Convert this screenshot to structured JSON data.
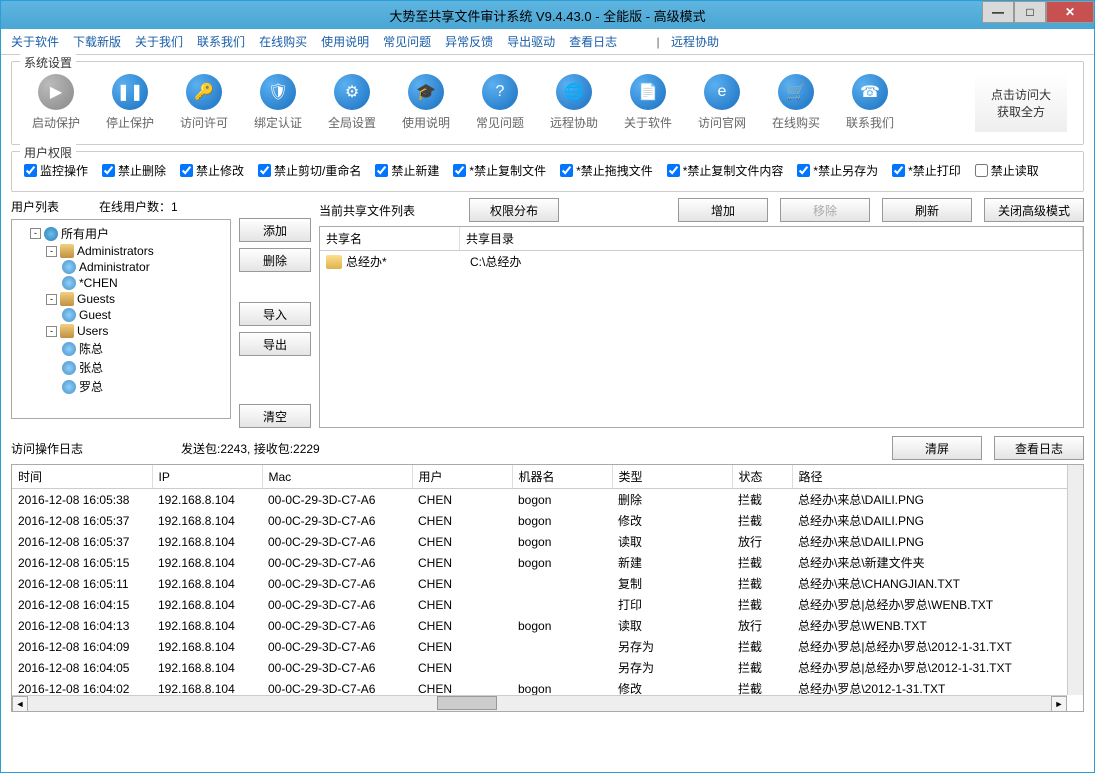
{
  "title": "大势至共享文件审计系统 V9.4.43.0 - 全能版 - 高级模式",
  "menu": [
    "关于软件",
    "下载新版",
    "关于我们",
    "联系我们",
    "在线购买",
    "使用说明",
    "常见问题",
    "异常反馈",
    "导出驱动",
    "查看日志"
  ],
  "menu_sep": "|",
  "menu_remote": "远程协助",
  "group_system": "系统设置",
  "toolbar": [
    {
      "label": "启动保护",
      "glyph": "▶",
      "gray": true
    },
    {
      "label": "停止保护",
      "glyph": "❚❚"
    },
    {
      "label": "访问许可",
      "glyph": "🔑"
    },
    {
      "label": "绑定认证",
      "glyph": "🛡"
    },
    {
      "label": "全局设置",
      "glyph": "⚙"
    },
    {
      "label": "使用说明",
      "glyph": "🎓"
    },
    {
      "label": "常见问题",
      "glyph": "?"
    },
    {
      "label": "远程协助",
      "glyph": "🌐"
    },
    {
      "label": "关于软件",
      "glyph": "📄"
    },
    {
      "label": "访问官网",
      "glyph": "e"
    },
    {
      "label": "在线购买",
      "glyph": "🛒"
    },
    {
      "label": "联系我们",
      "glyph": "☎"
    }
  ],
  "banner_l1": "点击访问大",
  "banner_l2": "获取全方",
  "group_perm": "用户权限",
  "perms": [
    {
      "label": "监控操作",
      "checked": true
    },
    {
      "label": "禁止删除",
      "checked": true
    },
    {
      "label": "禁止修改",
      "checked": true
    },
    {
      "label": "禁止剪切/重命名",
      "checked": true
    },
    {
      "label": "禁止新建",
      "checked": true
    },
    {
      "label": "*禁止复制文件",
      "checked": true
    },
    {
      "label": "*禁止拖拽文件",
      "checked": true
    },
    {
      "label": "*禁止复制文件内容",
      "checked": true
    },
    {
      "label": "*禁止另存为",
      "checked": true
    },
    {
      "label": "*禁止打印",
      "checked": true
    },
    {
      "label": "禁止读取",
      "checked": false
    }
  ],
  "user_list_label": "用户列表",
  "online_users": "在线用户数：1",
  "tree": {
    "root": "所有用户",
    "groups": [
      {
        "name": "Administrators",
        "users": [
          "Administrator",
          "*CHEN"
        ]
      },
      {
        "name": "Guests",
        "users": [
          "Guest"
        ]
      },
      {
        "name": "Users",
        "users": [
          "陈总",
          "张总",
          "罗总"
        ]
      }
    ]
  },
  "btns_col": [
    "添加",
    "删除",
    "导入",
    "导出",
    "清空"
  ],
  "share_label": "当前共享文件列表",
  "btn_perm_dist": "权限分布",
  "btn_add": "增加",
  "btn_remove": "移除",
  "btn_refresh": "刷新",
  "btn_close_adv": "关闭高级模式",
  "share_cols": {
    "name": "共享名",
    "dir": "共享目录"
  },
  "share_rows": [
    {
      "name": "总经办*",
      "dir": "C:\\总经办"
    }
  ],
  "log_label": "访问操作日志",
  "log_stats": "发送包:2243, 接收包:2229",
  "btn_clear": "清屏",
  "btn_viewlog": "查看日志",
  "log_cols": [
    "时间",
    "IP",
    "Mac",
    "用户",
    "机器名",
    "类型",
    "状态",
    "路径"
  ],
  "log_rows": [
    [
      "2016-12-08 16:05:38",
      "192.168.8.104",
      "00-0C-29-3D-C7-A6",
      "CHEN",
      "bogon",
      "删除",
      "拦截",
      "总经办\\来总\\DAILI.PNG"
    ],
    [
      "2016-12-08 16:05:37",
      "192.168.8.104",
      "00-0C-29-3D-C7-A6",
      "CHEN",
      "bogon",
      "修改",
      "拦截",
      "总经办\\来总\\DAILI.PNG"
    ],
    [
      "2016-12-08 16:05:37",
      "192.168.8.104",
      "00-0C-29-3D-C7-A6",
      "CHEN",
      "bogon",
      "读取",
      "放行",
      "总经办\\来总\\DAILI.PNG"
    ],
    [
      "2016-12-08 16:05:15",
      "192.168.8.104",
      "00-0C-29-3D-C7-A6",
      "CHEN",
      "bogon",
      "新建",
      "拦截",
      "总经办\\来总\\新建文件夹"
    ],
    [
      "2016-12-08 16:05:11",
      "192.168.8.104",
      "00-0C-29-3D-C7-A6",
      "CHEN",
      "",
      "复制",
      "拦截",
      "总经办\\来总\\CHANGJIAN.TXT"
    ],
    [
      "2016-12-08 16:04:15",
      "192.168.8.104",
      "00-0C-29-3D-C7-A6",
      "CHEN",
      "",
      "打印",
      "拦截",
      "总经办\\罗总|总经办\\罗总\\WENB.TXT"
    ],
    [
      "2016-12-08 16:04:13",
      "192.168.8.104",
      "00-0C-29-3D-C7-A6",
      "CHEN",
      "bogon",
      "读取",
      "放行",
      "总经办\\罗总\\WENB.TXT"
    ],
    [
      "2016-12-08 16:04:09",
      "192.168.8.104",
      "00-0C-29-3D-C7-A6",
      "CHEN",
      "",
      "另存为",
      "拦截",
      "总经办\\罗总|总经办\\罗总\\2012-1-31.TXT"
    ],
    [
      "2016-12-08 16:04:05",
      "192.168.8.104",
      "00-0C-29-3D-C7-A6",
      "CHEN",
      "",
      "另存为",
      "拦截",
      "总经办\\罗总|总经办\\罗总\\2012-1-31.TXT"
    ],
    [
      "2016-12-08 16:04:02",
      "192.168.8.104",
      "00-0C-29-3D-C7-A6",
      "CHEN",
      "bogon",
      "修改",
      "拦截",
      "总经办\\罗总\\2012-1-31.TXT"
    ]
  ]
}
